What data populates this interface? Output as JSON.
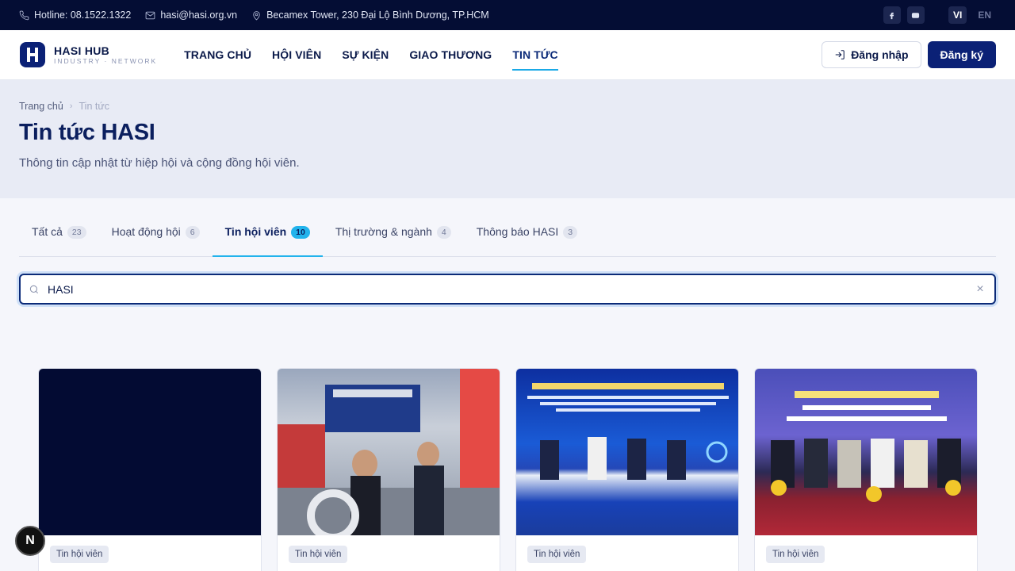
{
  "topbar": {
    "hotline": "Hotline: 08.1522.1322",
    "email": "hasi@hasi.org.vn",
    "address": "Becamex Tower, 230 Đại Lộ Bình Dương, TP.HCM",
    "lang_vi": "VI",
    "lang_en": "EN"
  },
  "header": {
    "logo_title": "HASI HUB",
    "logo_sub": "INDUSTRY · NETWORK",
    "nav": [
      "TRANG CHỦ",
      "HỘI VIÊN",
      "SỰ KIỆN",
      "GIAO THƯƠNG",
      "TIN TỨC"
    ],
    "login": "Đăng nhập",
    "register": "Đăng ký"
  },
  "hero": {
    "breadcrumb_home": "Trang chủ",
    "breadcrumb_current": "Tin tức",
    "title": "Tin tức HASI",
    "subtitle": "Thông tin cập nhật từ hiệp hội và cộng đồng hội viên."
  },
  "tabs": [
    {
      "label": "Tất cả",
      "count": "23"
    },
    {
      "label": "Hoạt động hội",
      "count": "6"
    },
    {
      "label": "Tin hội viên",
      "count": "10"
    },
    {
      "label": "Thị trường & ngành",
      "count": "4"
    },
    {
      "label": "Thông báo HASI",
      "count": "3"
    }
  ],
  "search": {
    "value": "HASI"
  },
  "cards": [
    {
      "tag": "Tin hội viên"
    },
    {
      "tag": "Tin hội viên"
    },
    {
      "tag": "Tin hội viên"
    },
    {
      "tag": "Tin hội viên"
    }
  ],
  "fab": "N",
  "colors": {
    "navy": "#040d34",
    "accent": "#22b3ec",
    "primary": "#0b2176"
  }
}
